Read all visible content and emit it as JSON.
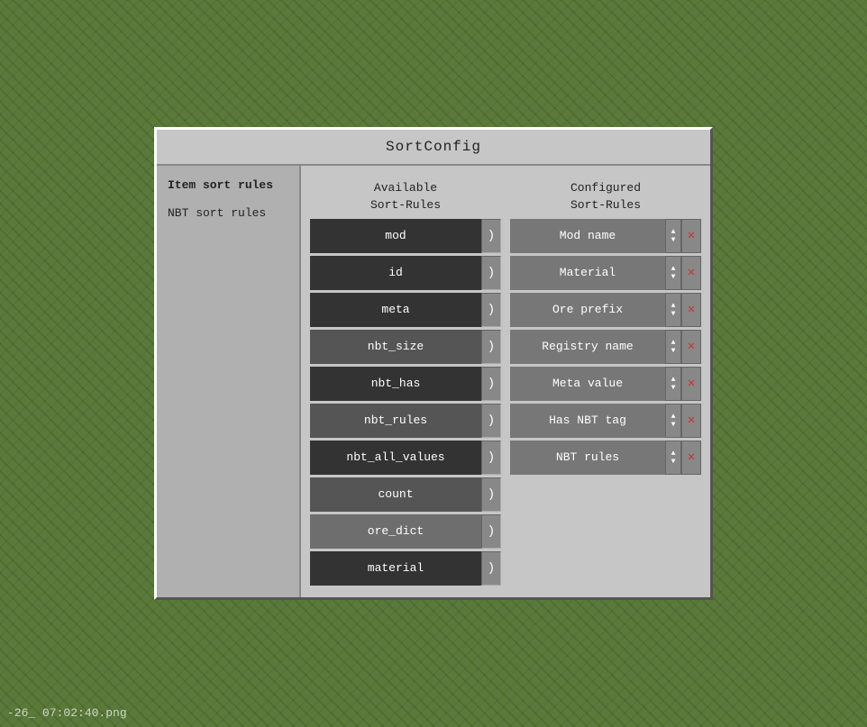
{
  "watermark": {
    "text": "-26_ 07:02:40.png"
  },
  "dialog": {
    "title": "SortConfig",
    "left_panel": {
      "items": [
        {
          "id": "item-sort-rules",
          "label": "Item sort rules",
          "active": true
        },
        {
          "id": "nbt-sort-rules",
          "label": "NBT sort rules",
          "active": false
        }
      ]
    },
    "available_column": {
      "header": "Available\nSort-Rules",
      "arrow_symbol": ")",
      "items": [
        {
          "id": "mod",
          "label": "mod",
          "bg": "dark"
        },
        {
          "id": "id",
          "label": "id",
          "bg": "dark"
        },
        {
          "id": "meta",
          "label": "meta",
          "bg": "dark"
        },
        {
          "id": "nbt_size",
          "label": "nbt_size",
          "bg": "medium"
        },
        {
          "id": "nbt_has",
          "label": "nbt_has",
          "bg": "dark"
        },
        {
          "id": "nbt_rules",
          "label": "nbt_rules",
          "bg": "medium"
        },
        {
          "id": "nbt_all_values",
          "label": "nbt_all_values",
          "bg": "dark"
        },
        {
          "id": "count",
          "label": "count",
          "bg": "medium"
        },
        {
          "id": "ore_dict",
          "label": "ore_dict",
          "bg": "light"
        },
        {
          "id": "material",
          "label": "material",
          "bg": "dark"
        }
      ]
    },
    "configured_column": {
      "header": "Configured\nSort-Rules",
      "updown_symbol": "⬍",
      "remove_symbol": "✕",
      "items": [
        {
          "id": "mod-name",
          "label": "Mod name"
        },
        {
          "id": "material",
          "label": "Material"
        },
        {
          "id": "ore-prefix",
          "label": "Ore prefix"
        },
        {
          "id": "registry-name",
          "label": "Registry name"
        },
        {
          "id": "meta-value",
          "label": "Meta value"
        },
        {
          "id": "has-nbt-tag",
          "label": "Has NBT tag"
        },
        {
          "id": "nbt-rules",
          "label": "NBT rules"
        }
      ]
    }
  }
}
